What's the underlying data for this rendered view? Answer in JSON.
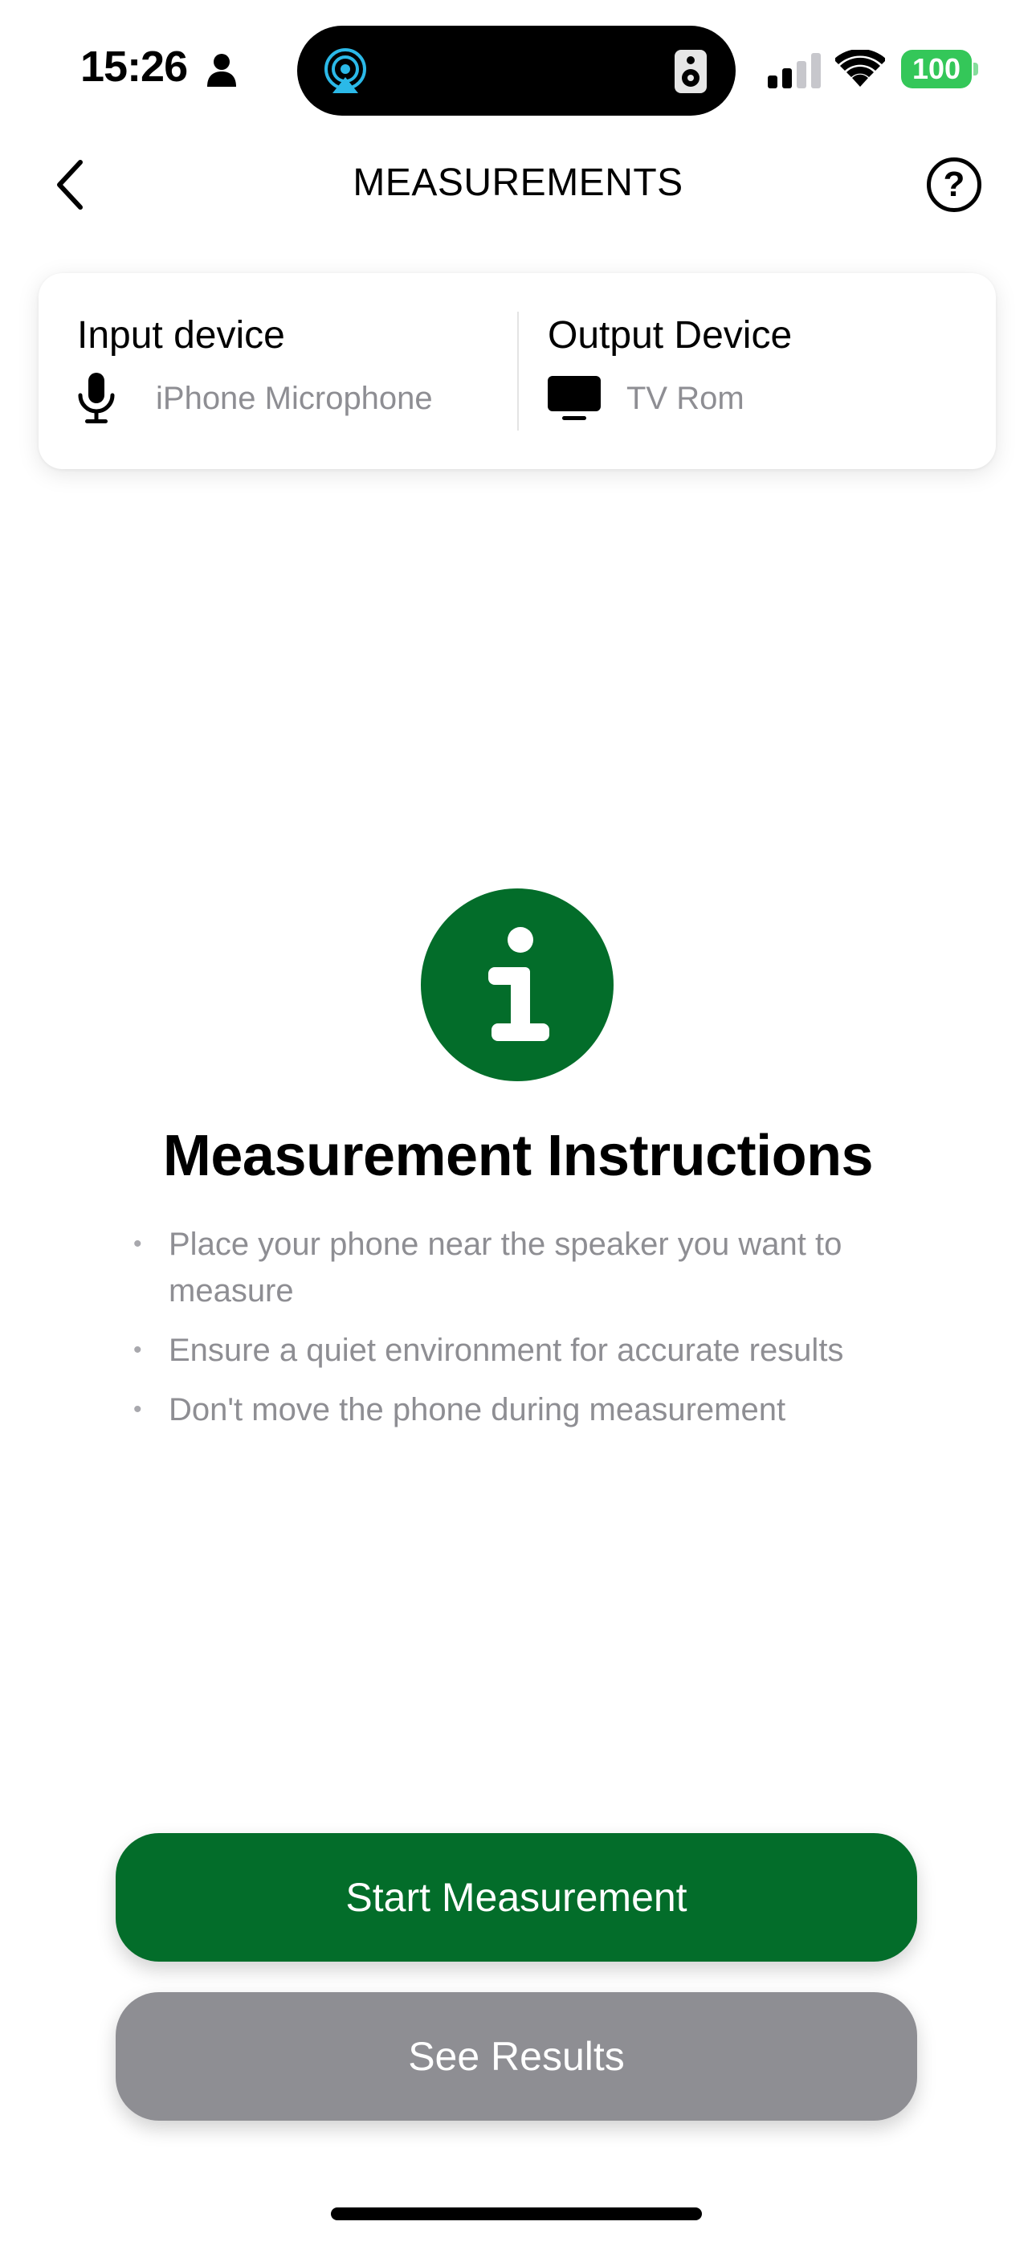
{
  "status_bar": {
    "time": "15:26",
    "battery_level": "100",
    "icons": [
      "person-icon",
      "airplay-icon",
      "speaker-icon",
      "cellular-signal-icon",
      "wifi-icon",
      "battery-icon"
    ],
    "battery_color": "#34c759",
    "airplay_color": "#2bb9e8"
  },
  "nav": {
    "title": "MEASUREMENTS",
    "back_icon": "chevron-left-icon",
    "help_label": "?"
  },
  "devices": {
    "input": {
      "heading": "Input device",
      "name": "iPhone Microphone",
      "icon": "microphone-icon"
    },
    "output": {
      "heading": "Output Device",
      "name": "TV Rom",
      "icon": "tv-icon"
    }
  },
  "instructions": {
    "icon": "info-icon",
    "title": "Measurement Instructions",
    "bullet_symbol": "•",
    "items": [
      "Place your phone near the speaker you want to measure",
      "Ensure a quiet environment for accurate results",
      "Don't move the phone during measurement"
    ]
  },
  "buttons": {
    "start": "Start Measurement",
    "results": "See Results"
  },
  "colors": {
    "accent": "#036d2a",
    "disabled": "#8e8e93",
    "secondary_text": "#8e8e93"
  }
}
